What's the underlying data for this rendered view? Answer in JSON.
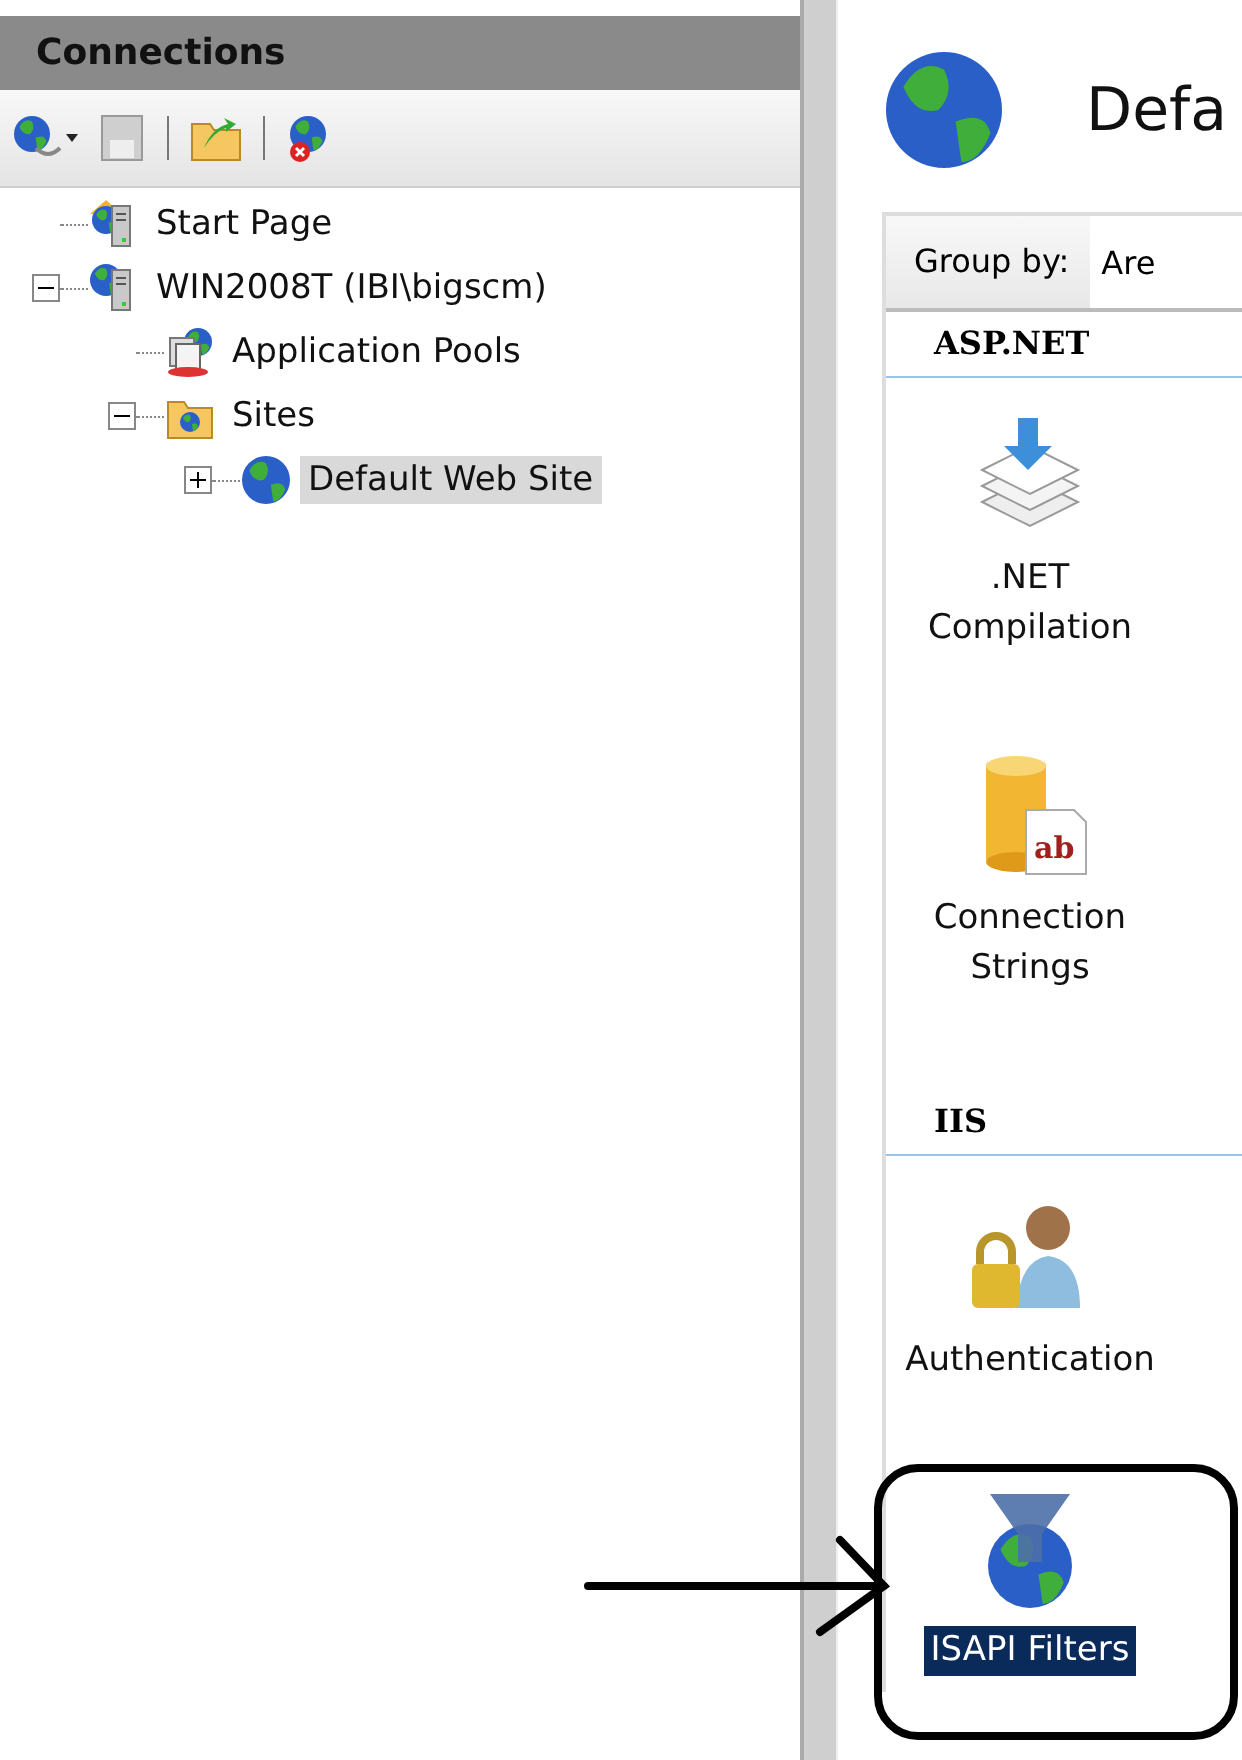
{
  "connections_panel": {
    "title": "Connections",
    "toolbar": [
      {
        "kind": "connect",
        "dropdown": true
      },
      {
        "kind": "save",
        "disabled": true
      },
      {
        "kind": "separator"
      },
      {
        "kind": "folder-up",
        "disabled": false
      },
      {
        "kind": "separator"
      },
      {
        "kind": "disconnect",
        "disabled": false
      }
    ],
    "tree": [
      {
        "label": "Start Page",
        "kind": "start",
        "selected": false
      },
      {
        "label": "WIN2008T (IBI\\bigscm)",
        "kind": "server",
        "selected": false,
        "expanded": true,
        "children": [
          {
            "label": "Application Pools",
            "kind": "pools",
            "selected": false
          },
          {
            "label": "Sites",
            "kind": "sites",
            "selected": false,
            "expanded": true,
            "children": [
              {
                "label": "Default Web Site",
                "kind": "site",
                "selected": true,
                "expanded": false
              }
            ]
          }
        ]
      }
    ]
  },
  "features_panel": {
    "title": "Defa",
    "group_by": {
      "label": "Group by:",
      "value": "Are"
    },
    "groups": [
      {
        "name": "ASP.NET",
        "features": [
          {
            "label": ".NET Compilation",
            "kind": "compilation",
            "selected": false
          },
          {
            "label": "Connection Strings",
            "kind": "connection-strings",
            "icon_text": "ab",
            "selected": false
          }
        ]
      },
      {
        "name": "IIS",
        "features": [
          {
            "label": "Authentication",
            "kind": "authentication",
            "selected": false
          },
          {
            "label": "ISAPI Filters",
            "kind": "isapi",
            "selected": true
          }
        ]
      }
    ]
  }
}
